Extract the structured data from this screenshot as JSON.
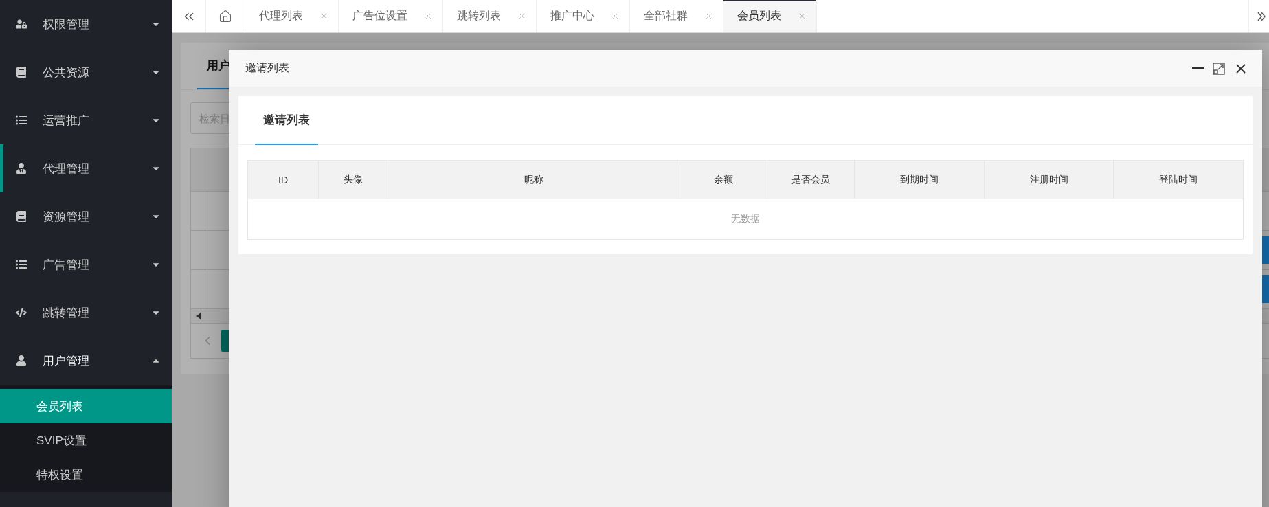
{
  "sidebar": {
    "items": [
      {
        "label": "权限管理",
        "expanded": false,
        "highlighted": false
      },
      {
        "label": "公共资源",
        "expanded": false,
        "highlighted": false
      },
      {
        "label": "运营推广",
        "expanded": false,
        "highlighted": false
      },
      {
        "label": "代理管理",
        "expanded": false,
        "highlighted": true
      },
      {
        "label": "资源管理",
        "expanded": false,
        "highlighted": false
      },
      {
        "label": "广告管理",
        "expanded": false,
        "highlighted": false
      },
      {
        "label": "跳转管理",
        "expanded": false,
        "highlighted": false
      },
      {
        "label": "用户管理",
        "expanded": true,
        "highlighted": false,
        "children": [
          {
            "label": "会员列表",
            "selected": true
          },
          {
            "label": "SVIP设置",
            "selected": false
          },
          {
            "label": "特权设置",
            "selected": false
          }
        ]
      }
    ]
  },
  "tabs": [
    {
      "label": "代理列表",
      "selected": false
    },
    {
      "label": "广告位设置",
      "selected": false
    },
    {
      "label": "跳转列表",
      "selected": false
    },
    {
      "label": "推广中心",
      "selected": false
    },
    {
      "label": "全部社群",
      "selected": false
    },
    {
      "label": "会员列表",
      "selected": true
    }
  ],
  "background": {
    "tab_label": "用户",
    "search": {
      "placeholder": "检索日"
    }
  },
  "modal": {
    "title": "邀请列表",
    "tab": {
      "label": "邀请列表",
      "selected": true
    },
    "table": {
      "columns": [
        "ID",
        "头像",
        "昵称",
        "余额",
        "是否会员",
        "到期时间",
        "注册时间",
        "登陆时间"
      ],
      "empty_text": "无数据"
    }
  }
}
